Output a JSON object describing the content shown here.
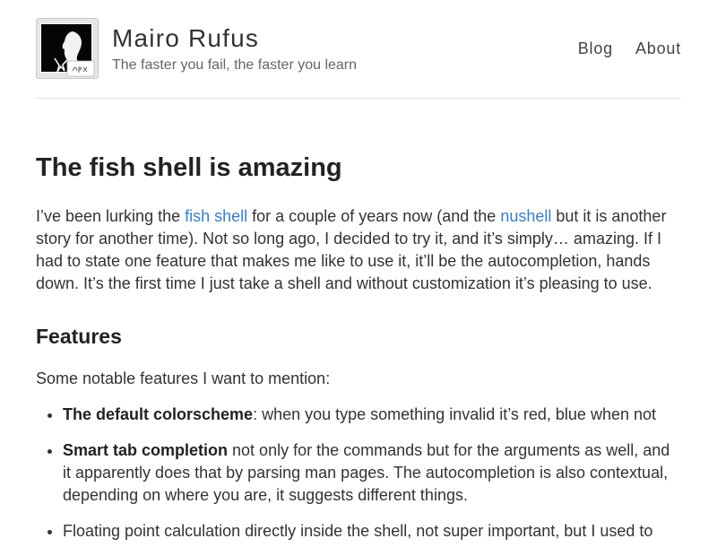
{
  "header": {
    "title": "Mairo Rufus",
    "tagline": "The faster you fail, the faster you learn",
    "avatar_icon": "portrait-silhouette-icon",
    "nav": [
      {
        "label": "Blog"
      },
      {
        "label": "About"
      }
    ]
  },
  "post": {
    "title": "The fish shell is amazing",
    "intro": {
      "part1": "I’ve been lurking the ",
      "link1": "fish shell",
      "part2": " for a couple of years now (and the ",
      "link2": "nushell",
      "part3": " but it is another story for another time). Not so long ago, I decided to try it, and it’s simply… amazing. If I had to state one feature that makes me like to use it, it’ll be the autocompletion, hands down. It’s the first time I just take a shell and without customization it’s pleasing to use."
    },
    "features_heading": "Features",
    "features_intro": "Some notable features I want to mention:",
    "features": [
      {
        "bold": "The default colorscheme",
        "text": ": when you type something invalid it’s red, blue when not"
      },
      {
        "bold": "Smart tab completion",
        "text": " not only for the commands but for the arguments as well, and it apparently does that by parsing man pages. The autocompletion is also contextual, depending on where you are, it suggests different things."
      },
      {
        "bold": "",
        "text": "Floating point calculation directly inside the shell, not super important, but I used to"
      }
    ]
  },
  "colors": {
    "link": "#3a7fbf",
    "text": "#333333",
    "heading": "#222222",
    "tagline": "#666666"
  }
}
